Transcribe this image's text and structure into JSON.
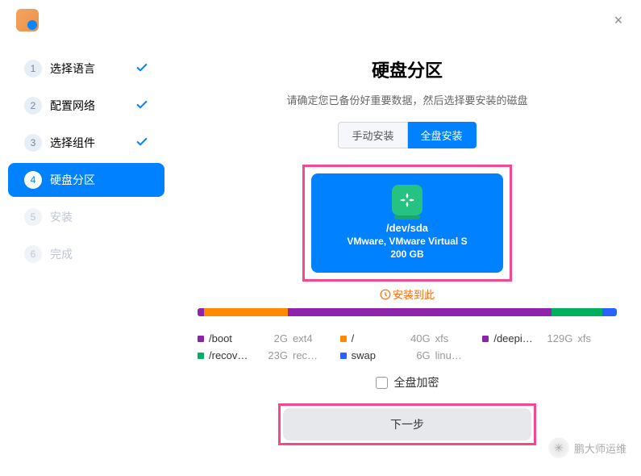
{
  "titlebar": {
    "close": "×"
  },
  "sidebar": {
    "steps": [
      {
        "num": "1",
        "label": "选择语言",
        "done": true
      },
      {
        "num": "2",
        "label": "配置网络",
        "done": true
      },
      {
        "num": "3",
        "label": "选择组件",
        "done": true
      },
      {
        "num": "4",
        "label": "硬盘分区",
        "active": true
      },
      {
        "num": "5",
        "label": "安装",
        "disabled": true
      },
      {
        "num": "6",
        "label": "完成",
        "disabled": true
      }
    ]
  },
  "main": {
    "title": "硬盘分区",
    "subtitle": "请确定您已备份好重要数据，然后选择要安装的磁盘",
    "tabs": {
      "manual": "手动安装",
      "full": "全盘安装"
    },
    "disk": {
      "device": "/dev/sda",
      "model": "VMware, VMware Virtual S",
      "size": "200 GB"
    },
    "install_here": "安装到此",
    "partitions": [
      {
        "name": "/boot",
        "size": "2G",
        "fs": "ext4",
        "color": "#8e24aa",
        "width": "1.5%"
      },
      {
        "name": "/",
        "size": "40G",
        "fs": "xfs",
        "color": "#ff8a00",
        "width": "20%"
      },
      {
        "name": "/deepi…",
        "size": "129G",
        "fs": "xfs",
        "color": "#8e24aa",
        "width": "63%"
      },
      {
        "name": "/recov…",
        "size": "23G",
        "fs": "rec…",
        "color": "#00b060",
        "width": "12%"
      },
      {
        "name": "swap",
        "size": "6G",
        "fs": "linu…",
        "color": "#2962ff",
        "width": "3.5%"
      }
    ],
    "encrypt_label": "全盘加密",
    "next": "下一步"
  },
  "watermark": "鹏大师运维"
}
